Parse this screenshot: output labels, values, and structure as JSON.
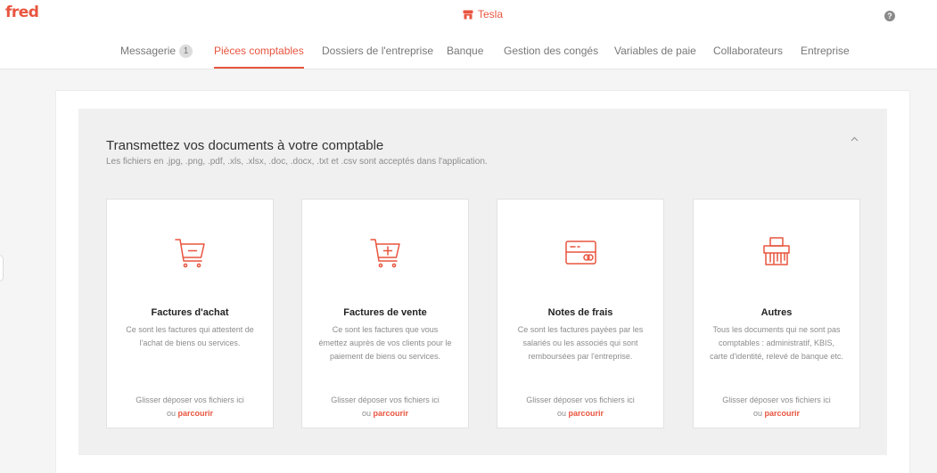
{
  "header": {
    "logo": "fred",
    "company": "Tesla",
    "help": "?"
  },
  "nav": {
    "items": [
      {
        "label": "Messagerie",
        "badge": "1"
      },
      {
        "label": "Pièces comptables"
      },
      {
        "label": "Dossiers de l'entreprise"
      },
      {
        "label": "Banque"
      },
      {
        "label": "Gestion des congés"
      },
      {
        "label": "Variables de paie"
      },
      {
        "label": "Collaborateurs"
      },
      {
        "label": "Entreprise"
      }
    ],
    "active": "Pièces comptables"
  },
  "panel": {
    "title": "Transmettez vos documents à votre comptable",
    "subtitle": "Les fichiers en .jpg, .png, .pdf, .xls, .xlsx, .doc, .docx, .txt et .csv sont acceptés dans l'application.",
    "collapse_icon": "chevron-up-icon"
  },
  "cards": [
    {
      "icon": "cart-minus-icon",
      "title": "Factures d'achat",
      "desc1": "Ce sont les factures qui attestent de",
      "desc2": "l'achat de biens ou services.",
      "desc3": "",
      "drop": "Glisser déposer vos fichiers ici",
      "or": "ou ",
      "browse": "parcourir"
    },
    {
      "icon": "cart-plus-icon",
      "title": "Factures de vente",
      "desc1": "Ce sont les factures que vous",
      "desc2": "émettez auprès de vos clients pour le",
      "desc3": "paiement de biens ou services.",
      "drop": "Glisser déposer vos fichiers ici",
      "or": "ou ",
      "browse": "parcourir"
    },
    {
      "icon": "credit-card-icon",
      "title": "Notes de frais",
      "desc1": "Ce sont les factures payées par les",
      "desc2": "salariés ou les associés qui sont",
      "desc3": "remboursées par l'entreprise.",
      "drop": "Glisser déposer vos fichiers ici",
      "or": "ou ",
      "browse": "parcourir"
    },
    {
      "icon": "shredder-icon",
      "title": "Autres",
      "desc1": "Tous les documents qui ne sont pas",
      "desc2": "comptables : administratif, KBIS,",
      "desc3": "carte d'identité, relevé de banque etc.",
      "drop": "Glisser déposer vos fichiers ici",
      "or": "ou ",
      "browse": "parcourir"
    }
  ],
  "colors": {
    "accent": "#e8553f",
    "panel_bg": "#f0f0f0",
    "page_bg": "#f5f5f5"
  }
}
